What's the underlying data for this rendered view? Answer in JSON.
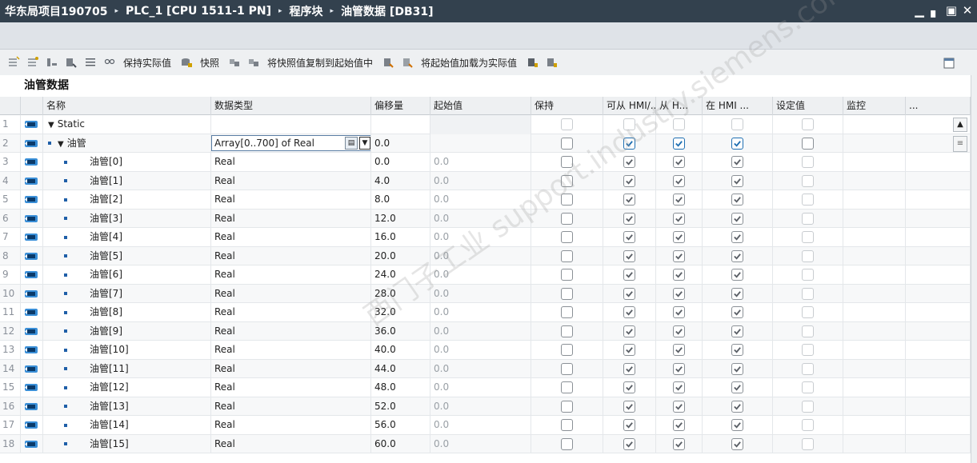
{
  "title": {
    "crumbs": [
      "华东局项目190705",
      "PLC_1 [CPU 1511-1 PN]",
      "程序块",
      "油管数据 [DB31]"
    ],
    "separator": "▸",
    "buttons": [
      "▁",
      "▖",
      "▣",
      "✕"
    ]
  },
  "toolbar": {
    "keep_actual": "保持实际值",
    "snapshot": "快照",
    "copy_snapshot": "将快照值复制到起始值中",
    "load_start": "将起始值加载为实际值"
  },
  "db_name": "油管数据",
  "columns": {
    "name": "名称",
    "type": "数据类型",
    "offset": "偏移量",
    "start": "起始值",
    "retain": "保持",
    "hmi_access": "可从 HMI/...",
    "hmi_write": "从 H...",
    "hmi_visible": "在 HMI ...",
    "setpoint": "设定值",
    "monitor": "监控",
    "more": "..."
  },
  "rows": [
    {
      "num": "1",
      "name": "Static",
      "type": "",
      "offset": "",
      "start": ""
    },
    {
      "num": "2",
      "name": "油管",
      "type": "Array[0..700] of Real",
      "offset": "0.0",
      "start": ""
    },
    {
      "num": "3",
      "name": "油管[0]",
      "type": "Real",
      "offset": "0.0",
      "start": "0.0"
    },
    {
      "num": "4",
      "name": "油管[1]",
      "type": "Real",
      "offset": "4.0",
      "start": "0.0"
    },
    {
      "num": "5",
      "name": "油管[2]",
      "type": "Real",
      "offset": "8.0",
      "start": "0.0"
    },
    {
      "num": "6",
      "name": "油管[3]",
      "type": "Real",
      "offset": "12.0",
      "start": "0.0"
    },
    {
      "num": "7",
      "name": "油管[4]",
      "type": "Real",
      "offset": "16.0",
      "start": "0.0"
    },
    {
      "num": "8",
      "name": "油管[5]",
      "type": "Real",
      "offset": "20.0",
      "start": "0.0"
    },
    {
      "num": "9",
      "name": "油管[6]",
      "type": "Real",
      "offset": "24.0",
      "start": "0.0"
    },
    {
      "num": "10",
      "name": "油管[7]",
      "type": "Real",
      "offset": "28.0",
      "start": "0.0"
    },
    {
      "num": "11",
      "name": "油管[8]",
      "type": "Real",
      "offset": "32.0",
      "start": "0.0"
    },
    {
      "num": "12",
      "name": "油管[9]",
      "type": "Real",
      "offset": "36.0",
      "start": "0.0"
    },
    {
      "num": "13",
      "name": "油管[10]",
      "type": "Real",
      "offset": "40.0",
      "start": "0.0"
    },
    {
      "num": "14",
      "name": "油管[11]",
      "type": "Real",
      "offset": "44.0",
      "start": "0.0"
    },
    {
      "num": "15",
      "name": "油管[12]",
      "type": "Real",
      "offset": "48.0",
      "start": "0.0"
    },
    {
      "num": "16",
      "name": "油管[13]",
      "type": "Real",
      "offset": "52.0",
      "start": "0.0"
    },
    {
      "num": "17",
      "name": "油管[14]",
      "type": "Real",
      "offset": "56.0",
      "start": "0.0"
    },
    {
      "num": "18",
      "name": "油管[15]",
      "type": "Real",
      "offset": "60.0",
      "start": "0.0"
    }
  ],
  "colors": {
    "titlebar": "#33414e",
    "accent": "#1f6fb2"
  },
  "icons": [
    "db-tag-icon",
    "checkbox-icon",
    "dropdown-icon"
  ]
}
